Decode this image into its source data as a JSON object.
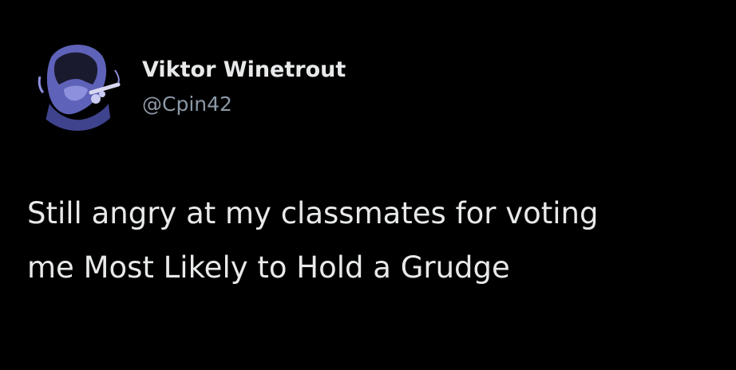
{
  "tweet": {
    "author": {
      "display_name": "Viktor Winetrout",
      "handle": "@Cpin42",
      "avatar_icon": "user-avatar-smoking-figure-icon"
    },
    "text_lines": [
      "Still angry at my classmates for voting",
      "me Most Likely to Hold a Grudge"
    ]
  },
  "colors": {
    "background": "#000000",
    "text_primary": "#e7e9ea",
    "text_secondary": "#8b98a5",
    "avatar_tint": "#6b6fc4"
  }
}
